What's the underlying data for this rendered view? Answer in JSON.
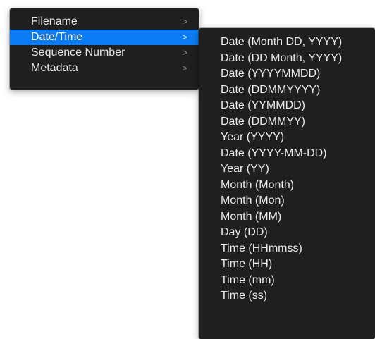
{
  "main_menu": {
    "items": [
      {
        "label": "Filename",
        "chevron": ">"
      },
      {
        "label": "Date/Time",
        "chevron": ">"
      },
      {
        "label": "Sequence Number",
        "chevron": ">"
      },
      {
        "label": "Metadata",
        "chevron": ">"
      }
    ],
    "selected_index": 1,
    "selected_color": "#0a7bf2",
    "background_color": "#1f1f1f"
  },
  "date_time_submenu": {
    "items": [
      "Date (Month DD, YYYY)",
      "Date (DD Month, YYYY)",
      "Date (YYYYMMDD)",
      "Date (DDMMYYYY)",
      "Date (YYMMDD)",
      "Date (DDMMYY)",
      "Year (YYYY)",
      "Date (YYYY-MM-DD)",
      "Year (YY)",
      "Month (Month)",
      "Month (Mon)",
      "Month (MM)",
      "Day (DD)",
      "Time (HHmmss)",
      "Time (HH)",
      "Time (mm)",
      "Time (ss)"
    ]
  }
}
